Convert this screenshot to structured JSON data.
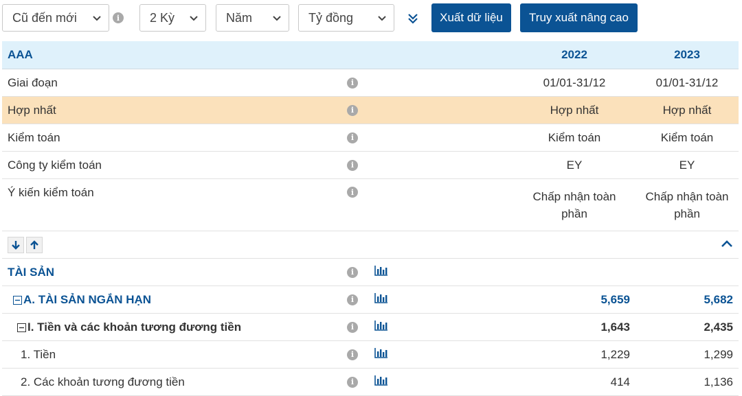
{
  "toolbar": {
    "sort": "Cũ đến mới",
    "periods": "2 Kỳ",
    "period_type": "Năm",
    "unit": "Tỷ đồng",
    "export_label": "Xuất dữ liệu",
    "advanced_label": "Truy xuất nâng cao"
  },
  "table": {
    "ticker": "AAA",
    "years": [
      "2022",
      "2023"
    ],
    "info_rows": [
      {
        "label": "Giai đoạn",
        "v2022": "01/01-31/12",
        "v2023": "01/01-31/12"
      },
      {
        "label": "Hợp nhất",
        "v2022": "Hợp nhất",
        "v2023": "Hợp nhất"
      },
      {
        "label": "Kiểm toán",
        "v2022": "Kiểm toán",
        "v2023": "Kiểm toán"
      },
      {
        "label": "Công ty kiểm toán",
        "v2022": "EY",
        "v2023": "EY"
      },
      {
        "label": "Ý kiến kiểm toán",
        "v2022": "Chấp nhận toàn phần",
        "v2023": "Chấp nhận toàn phần"
      }
    ],
    "section_title": "TÀI SẢN",
    "items": [
      {
        "label": "A. TÀI SẢN NGẮN HẠN",
        "v2022": "5,659",
        "v2023": "5,682"
      },
      {
        "label": "I. Tiền và các khoản tương đương tiền",
        "v2022": "1,643",
        "v2023": "2,435"
      },
      {
        "label": "1. Tiền",
        "v2022": "1,229",
        "v2023": "1,299"
      },
      {
        "label": "2. Các khoản tương đương tiền",
        "v2022": "414",
        "v2023": "1,136"
      }
    ]
  }
}
